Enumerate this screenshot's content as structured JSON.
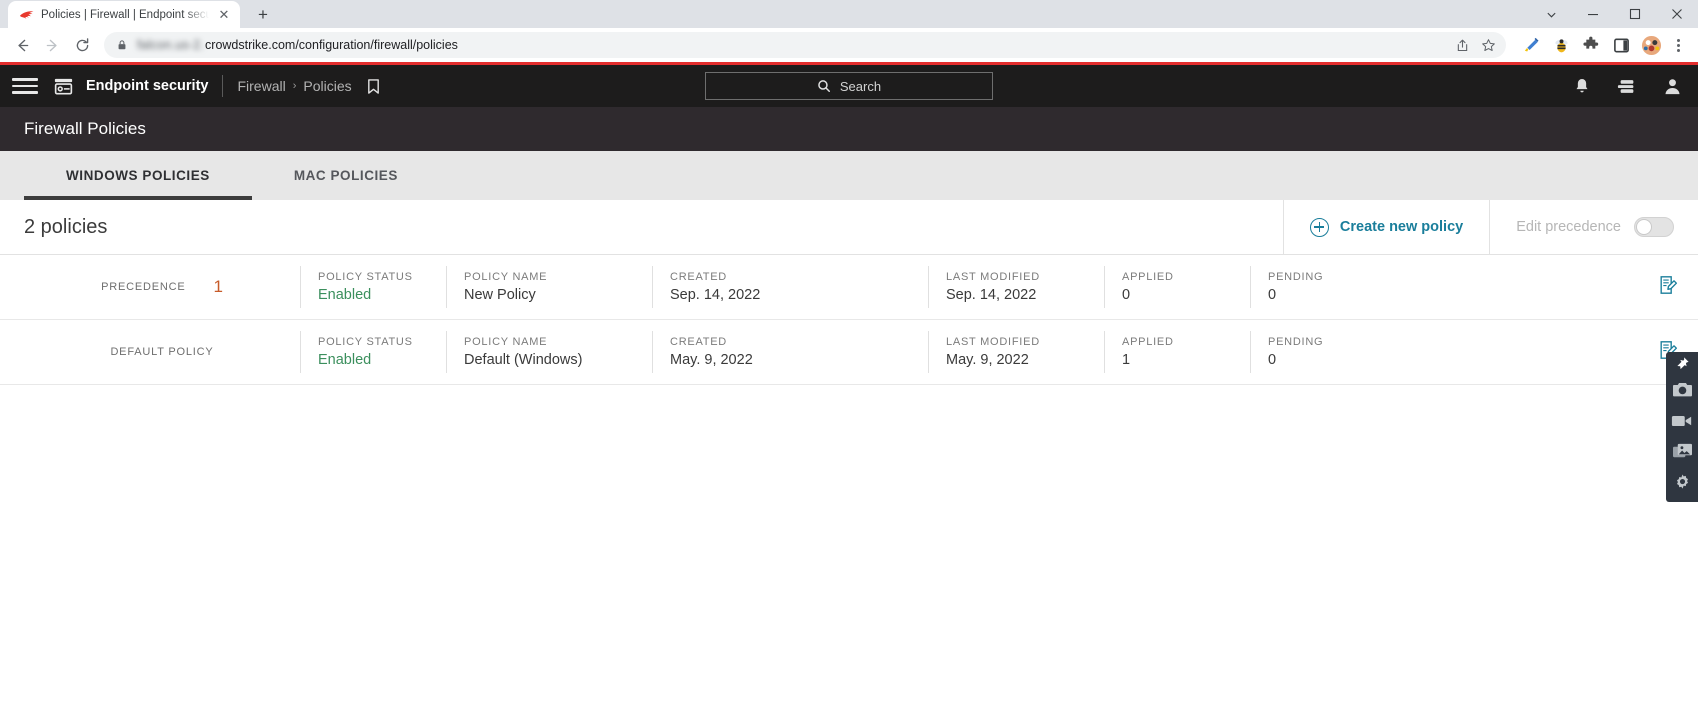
{
  "browser": {
    "tab": {
      "title": "Policies | Firewall | Endpoint secu",
      "favicon_name": "crowdstrike-falcon-favicon",
      "close_label": "✕"
    },
    "new_tab_label": "+",
    "window_controls": {
      "minimize": "—",
      "maximize": "☐",
      "close": "✕",
      "tab_search": "▼"
    },
    "nav": {
      "back": "←",
      "forward": "→",
      "reload": "⟳"
    },
    "omnibox": {
      "blurred_subdomain": "falcon.us-2.",
      "url": "crowdstrike.com/configuration/firewall/policies",
      "lock_icon": "lock-icon",
      "share_icon": "share-icon",
      "bookmark_star_icon": "star-icon"
    },
    "extensions": [
      "paintbrush-extension-icon",
      "bee-extension-icon",
      "puzzle-extensions-icon",
      "sidepanel-icon",
      "profile-avatar-icon"
    ],
    "menu_icon": "kebab-menu-icon"
  },
  "accent": {
    "red_rule": "#e32d2d",
    "teal": "#1a7e9b",
    "green": "#3b8f5d",
    "orange": "#c75b29"
  },
  "appnav": {
    "menu_icon": "hamburger-menu-icon",
    "product_icon": "endpoint-security-icon",
    "product_name": "Endpoint security",
    "breadcrumb": {
      "parent": "Firewall",
      "separator": "›",
      "current": "Policies"
    },
    "bookmark_icon": "bookmark-icon",
    "search": {
      "placeholder": "Search",
      "icon": "search-icon"
    },
    "right_icons": [
      {
        "name": "notifications-bell-icon"
      },
      {
        "name": "support-stack-icon"
      },
      {
        "name": "user-account-icon"
      }
    ]
  },
  "page": {
    "title": "Firewall Policies",
    "tabs": [
      {
        "label": "WINDOWS POLICIES",
        "active": true
      },
      {
        "label": "MAC POLICIES",
        "active": false
      }
    ],
    "action_bar": {
      "count_label": "2 policies",
      "create_label": "Create new policy",
      "create_icon": "circle-plus-icon",
      "edit_precedence_label": "Edit precedence",
      "edit_precedence_on": false
    },
    "columns": {
      "precedence": "PRECEDENCE",
      "default": "DEFAULT POLICY",
      "status": "POLICY STATUS",
      "name": "POLICY NAME",
      "created": "CREATED",
      "modified": "LAST MODIFIED",
      "applied": "APPLIED",
      "pending": "PENDING"
    },
    "rows": [
      {
        "precedence_label": "PRECEDENCE",
        "precedence_value": "1",
        "status": "Enabled",
        "name": "New Policy",
        "created": "Sep. 14, 2022",
        "modified": "Sep. 14, 2022",
        "applied": "0",
        "pending": "0",
        "action_icon": "edit-policy-icon"
      },
      {
        "precedence_label": "DEFAULT POLICY",
        "precedence_value": "",
        "status": "Enabled",
        "name": "Default (Windows)",
        "created": "May. 9, 2022",
        "modified": "May. 9, 2022",
        "applied": "1",
        "pending": "0",
        "action_icon": "edit-policy-icon"
      }
    ]
  },
  "capture_toolbar": {
    "items": [
      {
        "name": "pin-icon"
      },
      {
        "name": "camera-capture-icon"
      },
      {
        "name": "video-record-icon"
      },
      {
        "name": "image-gallery-icon"
      },
      {
        "name": "settings-gear-icon"
      }
    ]
  }
}
